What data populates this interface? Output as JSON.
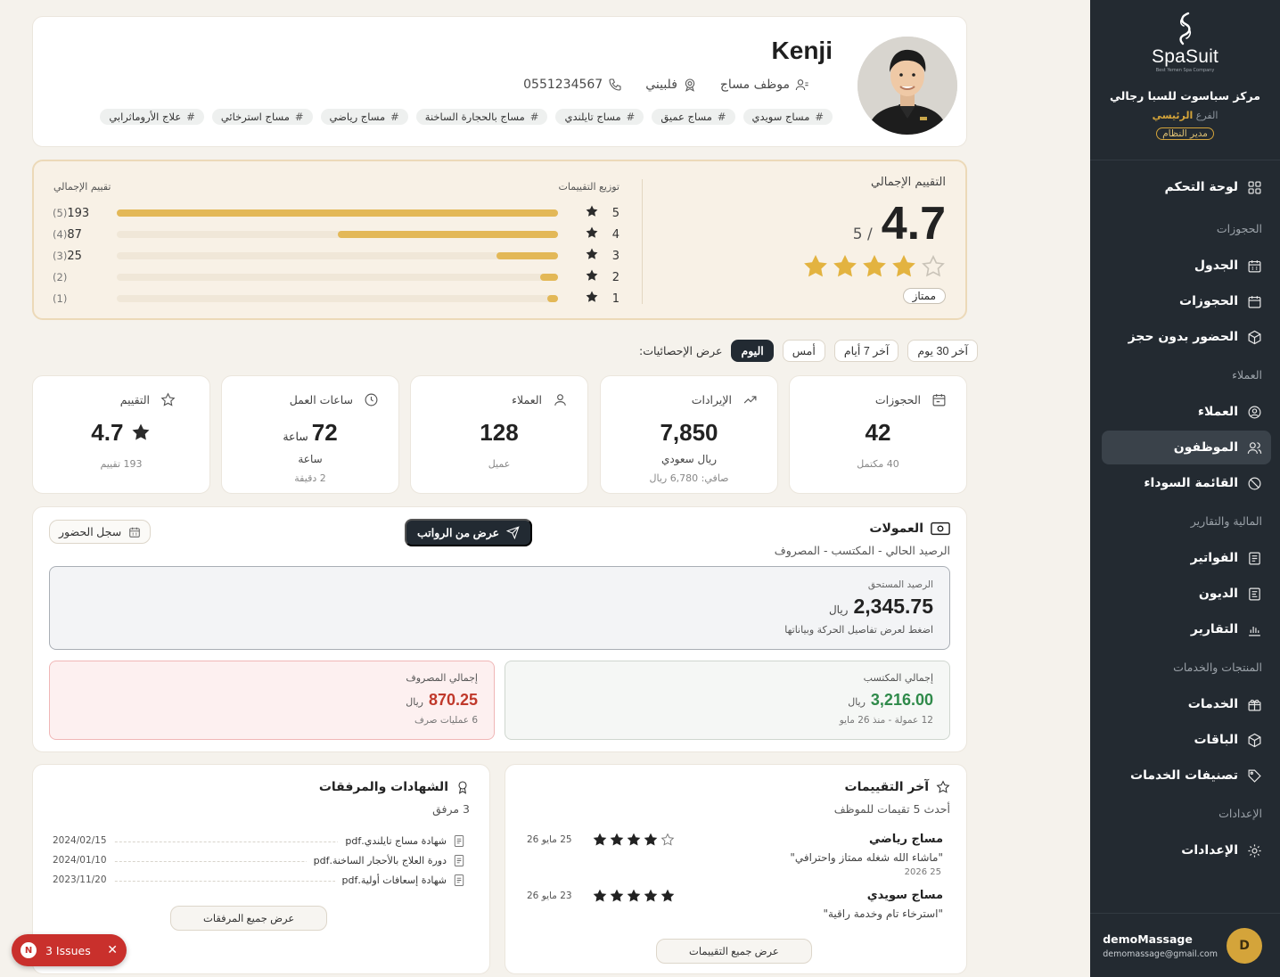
{
  "sidebar": {
    "brand": "SpaSuit",
    "brand_sub": "Best Yemen Spa Company",
    "center_name": "مركز سباسوت للسبا رجالي",
    "branch_label": "الفرع",
    "branch_name": "الرئيسي",
    "role": "مدير النظام",
    "dashboard": "لوحة التحكم",
    "sections": {
      "bookings": "الحجوزات",
      "customers": "العملاء",
      "finance": "المالية والتقارير",
      "products": "المنتجات والخدمات",
      "settings": "الإعدادات"
    },
    "items": {
      "schedule": "الجدول",
      "bookings": "الحجوزات",
      "walkin": "الحضور بدون حجز",
      "customers": "العملاء",
      "staff": "الموظفون",
      "blacklist": "القائمة السوداء",
      "invoices": "الفواتير",
      "debts": "الديون",
      "reports": "التقارير",
      "services": "الخدمات",
      "packages": "الباقات",
      "categories": "تصنيفات الخدمات",
      "settings": "الإعدادات"
    },
    "user": {
      "name": "demoMassage",
      "email": "demomassage@gmail.com",
      "initial": "D"
    }
  },
  "profile": {
    "name": "Kenji",
    "role": "موظف مساج",
    "nationality": "فلبيني",
    "phone": "0551234567",
    "tags": [
      "مساج سويدي",
      "مساج عميق",
      "مساج تايلندي",
      "مساج بالحجارة الساخنة",
      "مساج رياضي",
      "مساج استرخائي",
      "علاج الأروماثرابي"
    ]
  },
  "rating": {
    "title": "التقييم الإجمالي",
    "score": "4.7",
    "out_of": "/ 5",
    "score_value": 4.7,
    "badge": "ممتاز",
    "dist_title": "توزيع التقييمات",
    "total_title": "تقييم الإجمالي",
    "rows": [
      {
        "star": "5",
        "count": "193",
        "label": "(5)",
        "fraction": 1.0
      },
      {
        "star": "4",
        "count": "87",
        "label": "(4)",
        "fraction": 0.5
      },
      {
        "star": "3",
        "count": "25",
        "label": "(3)",
        "fraction": 0.14
      },
      {
        "star": "2",
        "count": "",
        "label": "(2)",
        "fraction": 0.04
      },
      {
        "star": "1",
        "count": "",
        "label": "(1)",
        "fraction": 0.025
      }
    ]
  },
  "period": {
    "label": "عرض الإحصائيات:",
    "options": [
      "اليوم",
      "أمس",
      "آخر 7 أيام",
      "آخر 30 يوم"
    ],
    "active": "اليوم"
  },
  "stats": {
    "bookings": {
      "title": "الحجوزات",
      "value": "42",
      "sub1": "40 مكتمل"
    },
    "revenue": {
      "title": "الإيرادات",
      "value": "7,850",
      "sub1": "ريال سعودي",
      "sub2": "صافي: 6,780 ريال"
    },
    "customers": {
      "title": "العملاء",
      "value": "128",
      "sub1": "عميل"
    },
    "hours": {
      "title": "ساعات العمل",
      "value": "72",
      "unit": "ساعة",
      "sub1": "ساعة",
      "sub2": "2 دقيقة"
    },
    "rating": {
      "title": "التقييم",
      "value": "4.7",
      "sub1": "193 تقييم"
    }
  },
  "commissions": {
    "title": "العمولات",
    "subtitle": "الرصيد الحالي - المكتسب - المصروف",
    "payroll_button": "عرض من الرواتب",
    "attendance_button": "سجل الحضور",
    "balance_label": "الرصيد المستحق",
    "balance_value": "2,345.75",
    "currency": "ريال",
    "balance_hint": "اضغط لعرض تفاصيل الحركة وبياناتها",
    "earned_label": "إجمالي المكتسب",
    "earned_value": "3,216.00",
    "earned_note": "12 عمولة - منذ 26 مايو",
    "spent_label": "إجمالي المصروف",
    "spent_value": "870.25",
    "spent_note": "6 عمليات صرف"
  },
  "reviews": {
    "title": "آخر التقييمات",
    "subtitle": "أحدث 5 تقيمات للموظف",
    "items": [
      {
        "service": "مساج رياضي",
        "quote": "\"ماشاء الله شغله ممتاز واحترافي\"",
        "qdate": "25 2026",
        "date": "25 مايو 26",
        "stars": 4
      },
      {
        "service": "مساج سويدي",
        "quote": "\"استرخاء تام وخدمة راقية\"",
        "qdate": "",
        "date": "23 مايو 26",
        "stars": 5
      }
    ],
    "button": "عرض جميع التقييمات"
  },
  "certificates": {
    "title": "الشهادات والمرفقات",
    "subtitle": "3 مرفق",
    "files": [
      {
        "name": "شهادة مساج تايلندي.pdf",
        "date": "2024/02/15"
      },
      {
        "name": "دورة العلاج بالأحجار الساخنة.pdf",
        "date": "2024/01/10"
      },
      {
        "name": "شهادة إسعافات أولية.pdf",
        "date": "2023/11/20"
      }
    ],
    "button": "عرض جميع المرفقات"
  },
  "issues": {
    "badge": "N",
    "label": "3 Issues",
    "close": "✕"
  },
  "colors": {
    "sidebar": "#232a31",
    "accent": "#d4a43a",
    "earned": "#2f8a4a",
    "spent": "#c0392b"
  }
}
